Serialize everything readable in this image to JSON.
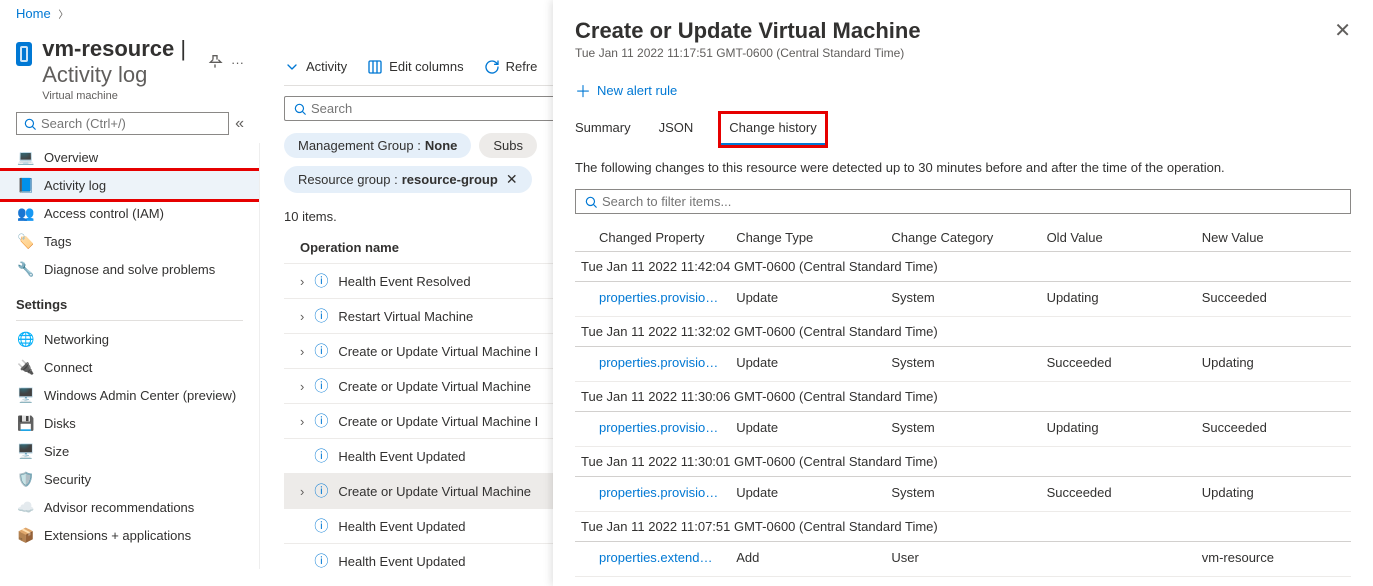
{
  "breadcrumb": {
    "home": "Home"
  },
  "resource": {
    "title": "vm-resource",
    "section": "Activity log",
    "subtitle": "Virtual machine"
  },
  "search": {
    "placeholder": "Search (Ctrl+/)"
  },
  "nav": {
    "items": [
      {
        "label": "Overview",
        "icon": "💻"
      },
      {
        "label": "Activity log",
        "icon": "📘",
        "selected": true,
        "highlight": true
      },
      {
        "label": "Access control (IAM)",
        "icon": "👥"
      },
      {
        "label": "Tags",
        "icon": "🏷️"
      },
      {
        "label": "Diagnose and solve problems",
        "icon": "🔧"
      }
    ],
    "settings_label": "Settings",
    "settings": [
      {
        "label": "Networking",
        "icon": "🌐"
      },
      {
        "label": "Connect",
        "icon": "🔌"
      },
      {
        "label": "Windows Admin Center (preview)",
        "icon": "🖥️"
      },
      {
        "label": "Disks",
        "icon": "💾"
      },
      {
        "label": "Size",
        "icon": "🖥️"
      },
      {
        "label": "Security",
        "icon": "🛡️"
      },
      {
        "label": "Advisor recommendations",
        "icon": "☁️"
      },
      {
        "label": "Extensions + applications",
        "icon": "📦"
      }
    ]
  },
  "toolbar": {
    "activity": "Activity",
    "edit_columns": "Edit columns",
    "refresh": "Refre"
  },
  "main_search": {
    "placeholder": "Search"
  },
  "filters": {
    "mgmt_label": "Management Group : ",
    "mgmt_value": "None",
    "sub_label": "Subs",
    "rg_label": "Resource group : ",
    "rg_value": "resource-group"
  },
  "items_count": "10 items.",
  "op_header": "Operation name",
  "operations": [
    {
      "label": "Health Event Resolved",
      "expand": true
    },
    {
      "label": "Restart Virtual Machine",
      "expand": true
    },
    {
      "label": "Create or Update Virtual Machine I",
      "expand": true
    },
    {
      "label": "Create or Update Virtual Machine",
      "expand": true
    },
    {
      "label": "Create or Update Virtual Machine I",
      "expand": true
    },
    {
      "label": "Health Event Updated",
      "expand": false
    },
    {
      "label": "Create or Update Virtual Machine",
      "expand": true,
      "selected": true
    },
    {
      "label": "Health Event Updated",
      "expand": false
    },
    {
      "label": "Health Event Updated",
      "expand": false
    }
  ],
  "blade": {
    "title": "Create or Update Virtual Machine",
    "subtitle": "Tue Jan 11 2022 11:17:51 GMT-0600 (Central Standard Time)",
    "new_alert": "New alert rule",
    "tabs": {
      "summary": "Summary",
      "json": "JSON",
      "change_history": "Change history"
    },
    "description": "The following changes to this resource were detected up to 30 minutes before and after the time of the operation.",
    "filter_placeholder": "Search to filter items...",
    "columns": {
      "prop": "Changed Property",
      "type": "Change Type",
      "cat": "Change Category",
      "old": "Old Value",
      "new": "New Value"
    },
    "groups": [
      {
        "time": "Tue Jan 11 2022 11:42:04 GMT-0600 (Central Standard Time)",
        "rows": [
          {
            "prop": "properties.provision…",
            "type": "Update",
            "cat": "System",
            "old": "Updating",
            "new": "Succeeded"
          }
        ]
      },
      {
        "time": "Tue Jan 11 2022 11:32:02 GMT-0600 (Central Standard Time)",
        "rows": [
          {
            "prop": "properties.provision…",
            "type": "Update",
            "cat": "System",
            "old": "Succeeded",
            "new": "Updating"
          }
        ]
      },
      {
        "time": "Tue Jan 11 2022 11:30:06 GMT-0600 (Central Standard Time)",
        "rows": [
          {
            "prop": "properties.provision…",
            "type": "Update",
            "cat": "System",
            "old": "Updating",
            "new": "Succeeded"
          }
        ]
      },
      {
        "time": "Tue Jan 11 2022 11:30:01 GMT-0600 (Central Standard Time)",
        "rows": [
          {
            "prop": "properties.provision…",
            "type": "Update",
            "cat": "System",
            "old": "Succeeded",
            "new": "Updating"
          }
        ]
      },
      {
        "time": "Tue Jan 11 2022 11:07:51 GMT-0600 (Central Standard Time)",
        "rows": [
          {
            "prop": "properties.extended…",
            "type": "Add",
            "cat": "User",
            "old": "",
            "new": "vm-resource"
          }
        ]
      }
    ]
  }
}
